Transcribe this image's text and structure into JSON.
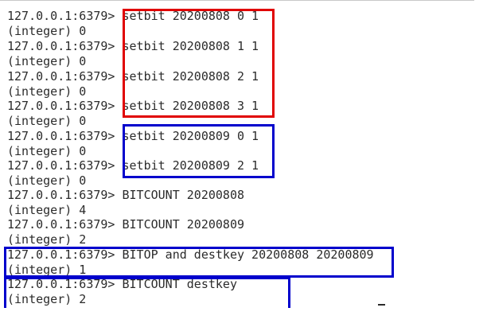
{
  "lines": [
    {
      "prompt": "127.0.0.1:6379> ",
      "command": "setbit 20200808 0 1"
    },
    {
      "output": "(integer) 0"
    },
    {
      "prompt": "127.0.0.1:6379> ",
      "command": "setbit 20200808 1 1"
    },
    {
      "output": "(integer) 0"
    },
    {
      "prompt": "127.0.0.1:6379> ",
      "command": "setbit 20200808 2 1"
    },
    {
      "output": "(integer) 0"
    },
    {
      "prompt": "127.0.0.1:6379> ",
      "command": "setbit 20200808 3 1"
    },
    {
      "output": "(integer) 0"
    },
    {
      "prompt": "127.0.0.1:6379> ",
      "command": "setbit 20200809 0 1"
    },
    {
      "output": "(integer) 0"
    },
    {
      "prompt": "127.0.0.1:6379> ",
      "command": "setbit 20200809 2 1"
    },
    {
      "output": "(integer) 0"
    },
    {
      "prompt": "127.0.0.1:6379> ",
      "command": "BITCOUNT 20200808"
    },
    {
      "output": "(integer) 4"
    },
    {
      "prompt": "127.0.0.1:6379> ",
      "command": "BITCOUNT 20200809"
    },
    {
      "output": "(integer) 2"
    },
    {
      "prompt": "127.0.0.1:6379> ",
      "command": "BITOP and destkey 20200808 20200809"
    },
    {
      "output": "(integer) 1"
    },
    {
      "prompt": "127.0.0.1:6379> ",
      "command": "BITCOUNT destkey"
    },
    {
      "output": "(integer) 2"
    }
  ],
  "highlight_colors": {
    "red": "#e00000",
    "blue": "#0000cc"
  }
}
